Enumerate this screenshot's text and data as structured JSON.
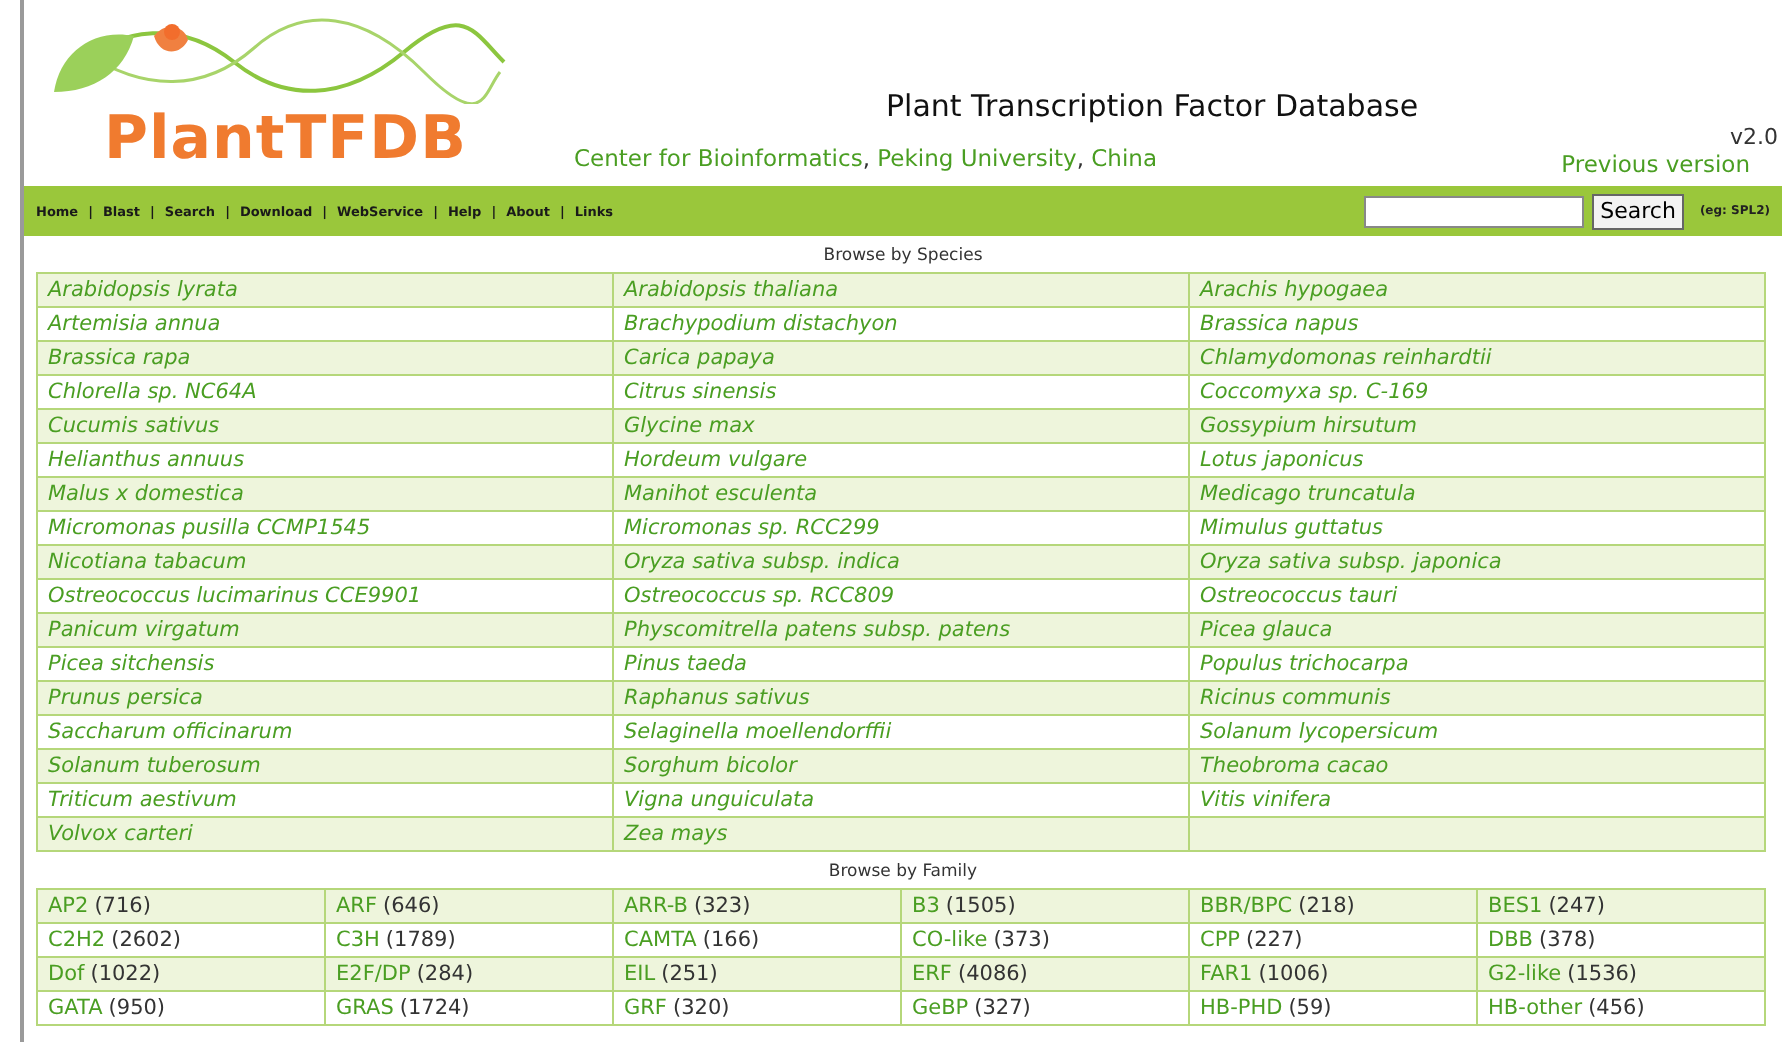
{
  "header": {
    "logo_text": "PlantTFDB",
    "title": "Plant Transcription Factor Database",
    "affiliation": {
      "links": [
        "Center for Bioinformatics",
        "Peking University",
        "China"
      ],
      "separator": ", "
    },
    "version": "v2.0",
    "previous_version_link": "Previous version"
  },
  "nav": {
    "items": [
      "Home",
      "Blast",
      "Search",
      "Download",
      "WebService",
      "Help",
      "About",
      "Links"
    ],
    "separator": "|"
  },
  "search": {
    "button": "Search",
    "hint": "(eg: SPL2)"
  },
  "species": {
    "heading": "Browse by Species",
    "rows": [
      [
        "Arabidopsis lyrata",
        "Arabidopsis thaliana",
        "Arachis hypogaea"
      ],
      [
        "Artemisia annua",
        "Brachypodium distachyon",
        "Brassica napus"
      ],
      [
        "Brassica rapa",
        "Carica papaya",
        "Chlamydomonas reinhardtii"
      ],
      [
        "Chlorella sp. NC64A",
        "Citrus sinensis",
        "Coccomyxa sp. C-169"
      ],
      [
        "Cucumis sativus",
        "Glycine max",
        "Gossypium hirsutum"
      ],
      [
        "Helianthus annuus",
        "Hordeum vulgare",
        "Lotus japonicus"
      ],
      [
        "Malus x domestica",
        "Manihot esculenta",
        "Medicago truncatula"
      ],
      [
        "Micromonas pusilla CCMP1545",
        "Micromonas sp. RCC299",
        "Mimulus guttatus"
      ],
      [
        "Nicotiana tabacum",
        "Oryza sativa subsp. indica",
        "Oryza sativa subsp. japonica"
      ],
      [
        "Ostreococcus lucimarinus CCE9901",
        "Ostreococcus sp. RCC809",
        "Ostreococcus tauri"
      ],
      [
        "Panicum virgatum",
        "Physcomitrella patens subsp. patens",
        "Picea glauca"
      ],
      [
        "Picea sitchensis",
        "Pinus taeda",
        "Populus trichocarpa"
      ],
      [
        "Prunus persica",
        "Raphanus sativus",
        "Ricinus communis"
      ],
      [
        "Saccharum officinarum",
        "Selaginella moellendorffii",
        "Solanum lycopersicum"
      ],
      [
        "Solanum tuberosum",
        "Sorghum bicolor",
        "Theobroma cacao"
      ],
      [
        "Triticum aestivum",
        "Vigna unguiculata",
        "Vitis vinifera"
      ],
      [
        "Volvox carteri",
        "Zea mays"
      ]
    ]
  },
  "families": {
    "heading": "Browse by Family",
    "rows": [
      [
        {
          "name": "AP2",
          "count": "(716)"
        },
        {
          "name": "ARF",
          "count": "(646)"
        },
        {
          "name": "ARR-B",
          "count": "(323)"
        },
        {
          "name": "B3",
          "count": "(1505)"
        },
        {
          "name": "BBR/BPC",
          "count": "(218)"
        },
        {
          "name": "BES1",
          "count": "(247)"
        }
      ],
      [
        {
          "name": "C2H2",
          "count": "(2602)"
        },
        {
          "name": "C3H",
          "count": "(1789)"
        },
        {
          "name": "CAMTA",
          "count": "(166)"
        },
        {
          "name": "CO-like",
          "count": "(373)"
        },
        {
          "name": "CPP",
          "count": "(227)"
        },
        {
          "name": "DBB",
          "count": "(378)"
        }
      ],
      [
        {
          "name": "Dof",
          "count": "(1022)"
        },
        {
          "name": "E2F/DP",
          "count": "(284)"
        },
        {
          "name": "EIL",
          "count": "(251)"
        },
        {
          "name": "ERF",
          "count": "(4086)"
        },
        {
          "name": "FAR1",
          "count": "(1006)"
        },
        {
          "name": "G2-like",
          "count": "(1536)"
        }
      ],
      [
        {
          "name": "GATA",
          "count": "(950)"
        },
        {
          "name": "GRAS",
          "count": "(1724)"
        },
        {
          "name": "GRF",
          "count": "(320)"
        },
        {
          "name": "GeBP",
          "count": "(327)"
        },
        {
          "name": "HB-PHD",
          "count": "(59)"
        },
        {
          "name": "HB-other",
          "count": "(456)"
        }
      ]
    ]
  }
}
